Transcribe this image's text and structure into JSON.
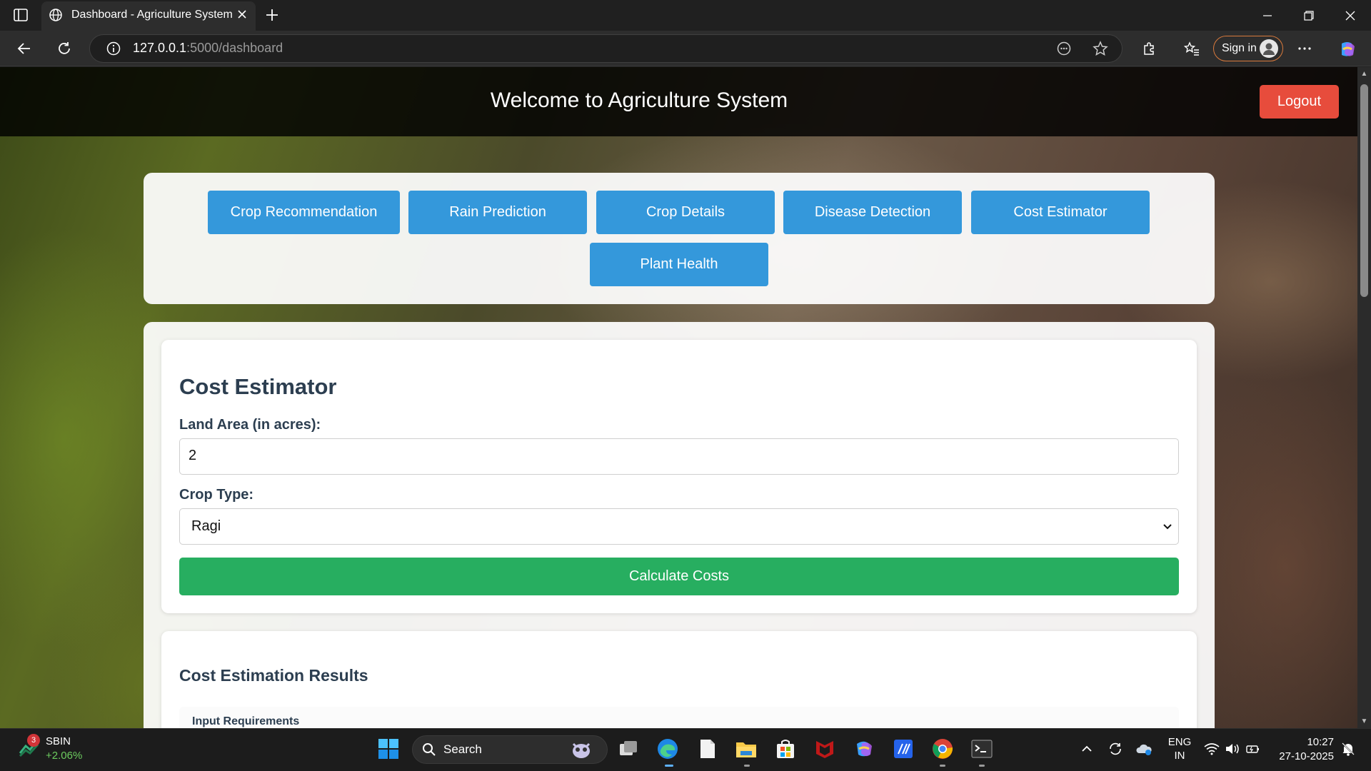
{
  "browser": {
    "tab_title": "Dashboard - Agriculture System",
    "url_host": "127.0.0.1",
    "url_path": ":5000/dashboard",
    "signin_label": "Sign in"
  },
  "header": {
    "title": "Welcome to Agriculture System",
    "logout_label": "Logout"
  },
  "nav": {
    "items": [
      {
        "label": "Crop Recommendation"
      },
      {
        "label": "Rain Prediction"
      },
      {
        "label": "Crop Details"
      },
      {
        "label": "Disease Detection"
      },
      {
        "label": "Cost Estimator"
      },
      {
        "label": "Plant Health"
      }
    ]
  },
  "form": {
    "title": "Cost Estimator",
    "land_area_label": "Land Area (in acres):",
    "land_area_value": "2",
    "crop_type_label": "Crop Type:",
    "crop_type_value": "Ragi",
    "submit_label": "Calculate Costs"
  },
  "results": {
    "title": "Cost Estimation Results",
    "section_title": "Input Requirements"
  },
  "taskbar": {
    "stock_name": "SBIN",
    "stock_change": "+2.06%",
    "stock_badge": "3",
    "search_label": "Search",
    "lang_primary": "ENG",
    "lang_secondary": "IN",
    "time": "10:27",
    "date": "27-10-2025"
  },
  "colors": {
    "nav_button": "#3498db",
    "logout": "#e74c3c",
    "calculate": "#27ae60",
    "heading": "#2c3e50"
  }
}
